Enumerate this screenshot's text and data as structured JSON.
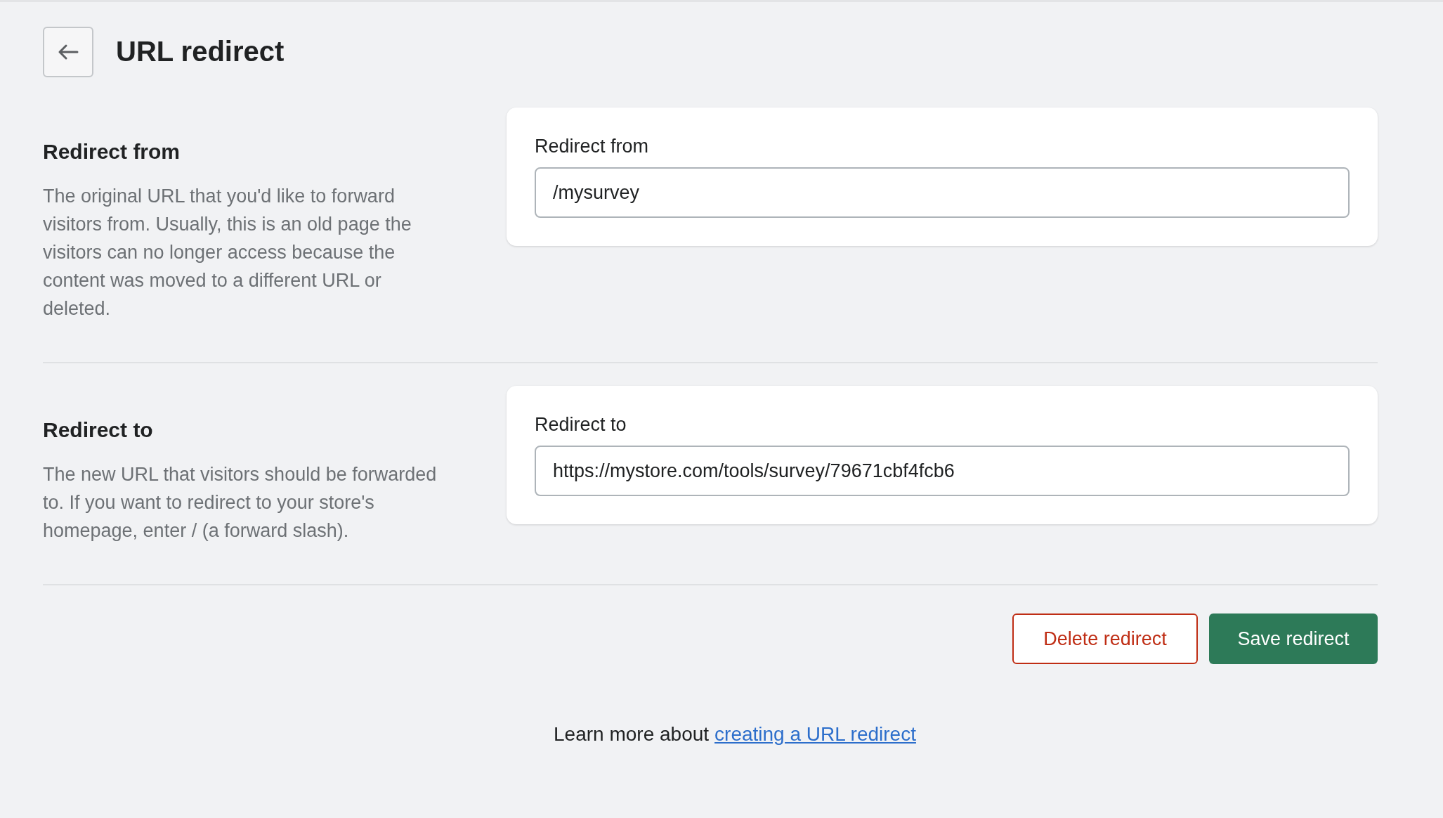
{
  "header": {
    "title": "URL redirect"
  },
  "sections": [
    {
      "heading": "Redirect from",
      "description": "The original URL that you'd like to forward visitors from. Usually, this is an old page the visitors can no longer access because the content was moved to a different URL or deleted.",
      "field": {
        "label": "Redirect from",
        "value": "/mysurvey"
      }
    },
    {
      "heading": "Redirect to",
      "description": "The new URL that visitors should be forwarded to. If you want to redirect to your store's homepage, enter / (a forward slash).",
      "field": {
        "label": "Redirect to",
        "value": "https://mystore.com/tools/survey/79671cbf4fcb6"
      }
    }
  ],
  "buttons": [
    {
      "label": "Delete redirect",
      "kind": "destructive"
    },
    {
      "label": "Save redirect",
      "kind": "primary"
    }
  ],
  "footer": {
    "text": "Learn more about",
    "link": "creating a URL redirect"
  }
}
